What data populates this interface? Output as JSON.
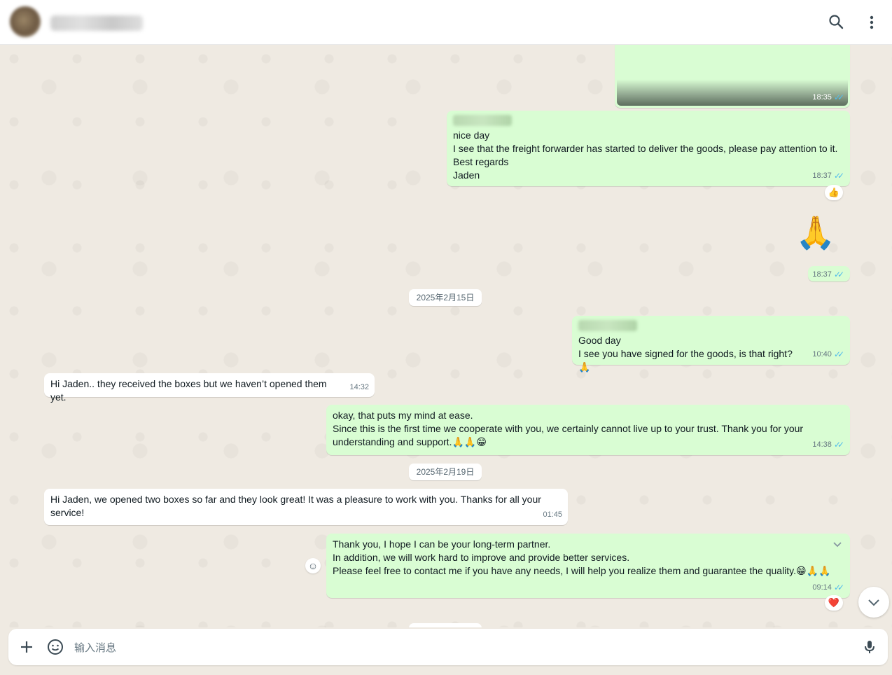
{
  "header": {
    "search_icon": "search-icon",
    "menu_icon": "more-vertical-icon"
  },
  "messages": [
    {
      "dir": "out",
      "time": "18:35",
      "type": "media"
    },
    {
      "dir": "out",
      "time": "18:37",
      "lines": [
        "nice day",
        "I see that the freight forwarder has started to deliver the goods, please pay attention to it.",
        "Best regards",
        "Jaden"
      ],
      "reaction": "👍"
    },
    {
      "dir": "out",
      "time": "18:37",
      "emoji": "🙏"
    },
    {
      "dir": "out",
      "time": "10:40",
      "lines": [
        "Good day",
        "I see you have signed for the goods, is that right?🙏"
      ]
    },
    {
      "dir": "in",
      "time": "14:32",
      "lines": [
        "Hi Jaden.. they received the boxes but we haven’t opened them yet."
      ]
    },
    {
      "dir": "out",
      "time": "14:38",
      "lines": [
        "okay, that puts my mind at ease.",
        "Since this is the first time we cooperate with you, we certainly cannot live up to your trust. Thank you for your understanding and support.🙏🙏😁"
      ]
    },
    {
      "dir": "in",
      "time": "01:45",
      "lines": [
        "Hi Jaden, we opened two boxes so far and they look great! It was a pleasure to work with you. Thanks for all your service!"
      ]
    },
    {
      "dir": "out",
      "time": "09:14",
      "lines": [
        "Thank you, I hope I can be your long-term partner.",
        "In addition, we will work hard to improve and provide better services.",
        "Please feel free to contact me if you have any needs, I will help you realize them and guarantee the quality.😁🙏🙏"
      ],
      "reaction": "❤️"
    }
  ],
  "dates": [
    "2025年2月15日",
    "2025年2月19日"
  ],
  "composer": {
    "placeholder": "输入消息"
  },
  "colors": {
    "outgoing_bubble": "#d9fdd3",
    "incoming_bubble": "#ffffff",
    "chat_background": "#efeae2",
    "read_ticks": "#53bdeb"
  }
}
